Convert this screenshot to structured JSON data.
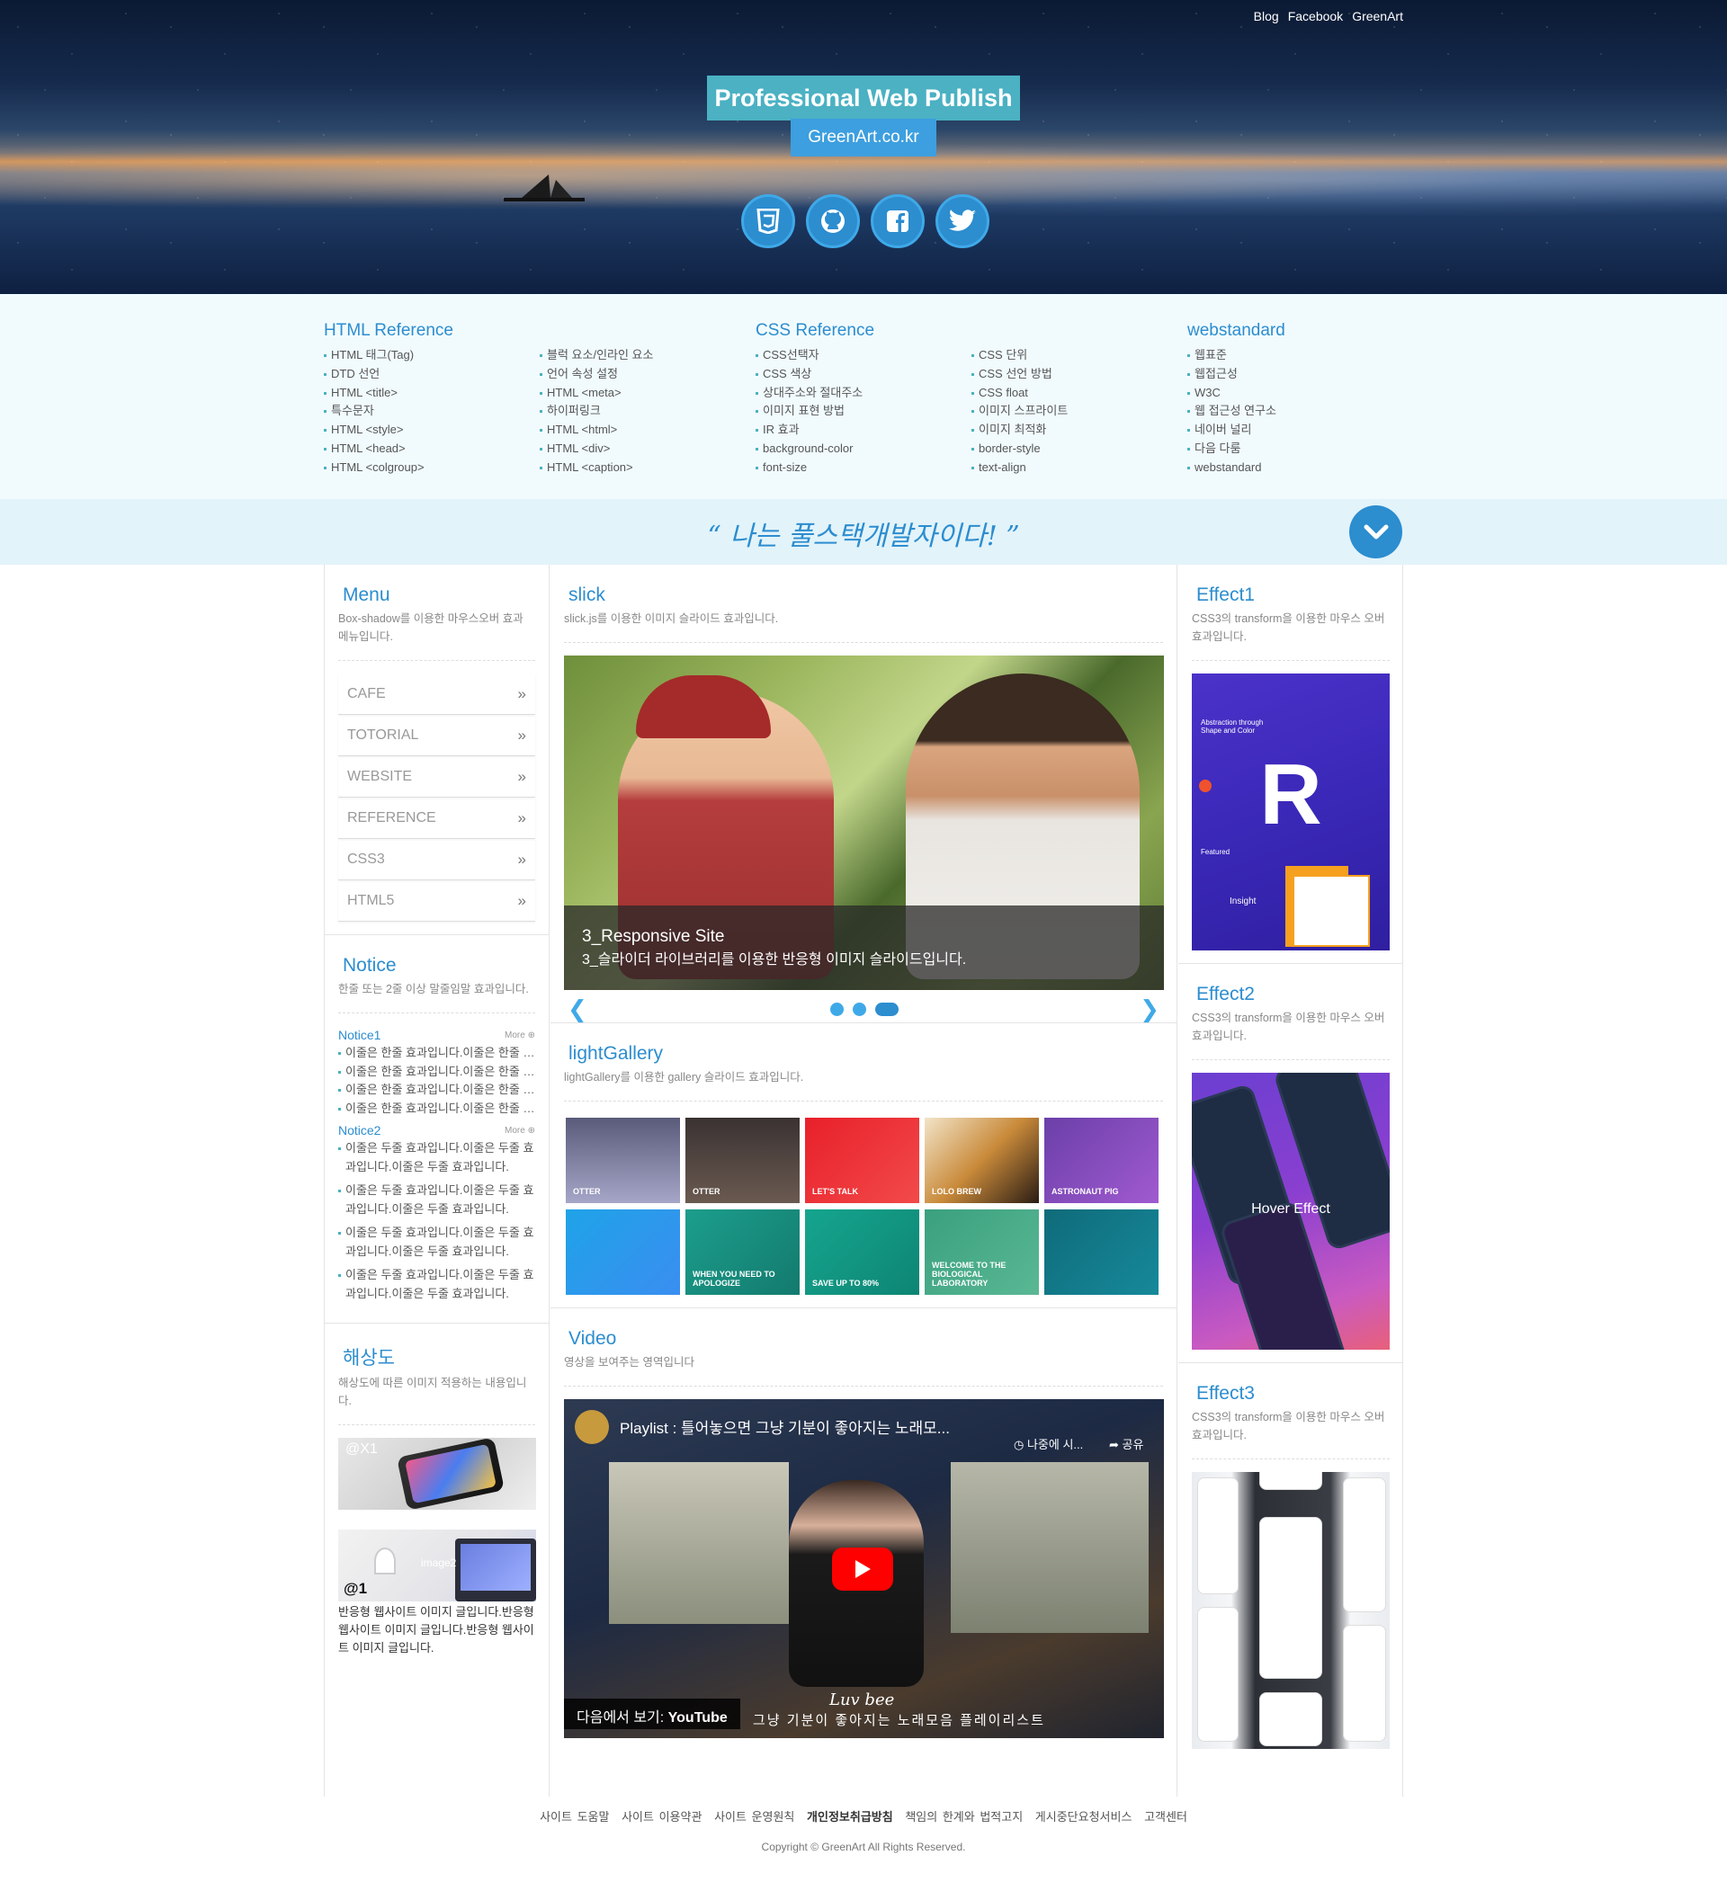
{
  "header": {
    "top_links": [
      "Blog",
      "Facebook",
      "GreenArt"
    ],
    "title": "Professional Web Publish",
    "subtitle": "GreenArt.co.kr",
    "social_icons": [
      "css3-icon",
      "github-icon",
      "facebook-icon",
      "twitter-icon"
    ]
  },
  "reference": {
    "html_title": "HTML Reference",
    "html_col1": [
      "HTML 태그(Tag)",
      "DTD 선언",
      "HTML <title>",
      "특수문자",
      "HTML <style>",
      "HTML <head>",
      "HTML <colgroup>"
    ],
    "html_col2": [
      "블럭 요소/인라인 요소",
      "언어 속성 설정",
      "HTML <meta>",
      "하이퍼링크",
      "HTML <html>",
      "HTML <div>",
      "HTML <caption>"
    ],
    "css_title": "CSS Reference",
    "css_col1": [
      "CSS선택자",
      "CSS 색상",
      "상대주소와 절대주소",
      "이미지 표현 방법",
      "IR 효과",
      "background-color",
      "font-size"
    ],
    "css_col2": [
      "CSS 단위",
      "CSS 선언 방법",
      "CSS float",
      "이미지 스프라이트",
      "이미지 최적화",
      "border-style",
      "text-align"
    ],
    "web_title": "webstandard",
    "web_col": [
      "웹표준",
      "웹접근성",
      "W3C",
      "웹 접근성 연구소",
      "네이버 널리",
      "다음 다룸",
      "webstandard"
    ]
  },
  "quote": "“ 나는 풀스택개발자이다! ”",
  "left": {
    "menu_title": "Menu",
    "menu_desc": "Box-shadow를 이용한 마우스오버 효과 메뉴입니다.",
    "menu_items": [
      "CAFE",
      "TOTORIAL",
      "WEBSITE",
      "REFERENCE",
      "CSS3",
      "HTML5"
    ],
    "notice_title": "Notice",
    "notice_desc": "한줄 또는 2줄 이상 말줄임말 효과입니다.",
    "notice1_label": "Notice1",
    "notice2_label": "Notice2",
    "more_label": "More",
    "notice1": [
      "이줄은 한줄 효과입니다.이줄은 한줄 효과입니다.",
      "이줄은 한줄 효과입니다.이줄은 한줄 효과입니다.",
      "이줄은 한줄 효과입니다.이줄은 한줄 효과입니다.",
      "이줄은 한줄 효과입니다.이줄은 한줄 효과입니다."
    ],
    "notice2": [
      "이줄은 두줄 효과입니다.이줄은 두줄 효과입니다.이줄은 두줄 효과입니다.",
      "이줄은 두줄 효과입니다.이줄은 두줄 효과입니다.이줄은 두줄 효과입니다.",
      "이줄은 두줄 효과입니다.이줄은 두줄 효과입니다.이줄은 두줄 효과입니다.",
      "이줄은 두줄 효과입니다.이줄은 두줄 효과입니다.이줄은 두줄 효과입니다."
    ],
    "res_title": "해상도",
    "res_desc": "해상도에 따른 이미지 적용하는 내용입니다.",
    "res_img1_label": "@X1",
    "res_img2_label": "@1",
    "res_img2_sub": "image2",
    "res_text": "반응형 웹사이트 이미지 글입니다.반응형 웹사이트 이미지 글입니다.반응형 웹사이트 이미지 글입니다."
  },
  "center": {
    "slick_title": "slick",
    "slick_desc": "slick.js를 이용한 이미지 슬라이드 효과입니다.",
    "slide_title": "3_Responsive Site",
    "slide_text": "3_슬라이더 라이브러리를 이용한 반응형 이미지 슬라이드입니다.",
    "gallery_title": "lightGallery",
    "gallery_desc": "lightGallery를 이용한 gallery 슬라이드 효과입니다.",
    "gallery_labels": [
      "OTTER",
      "OTTER",
      "LET'S TALK",
      "LOLO BREW",
      "ASTRONAUT PIG",
      "",
      "WHEN YOU NEED TO APOLOGIZE",
      "SAVE UP TO 80%",
      "WELCOME TO THE BIOLOGICAL LABORATORY",
      ""
    ],
    "video_title": "Video",
    "video_desc": "영상을 보여주는 영역입니다",
    "video_heading": "Playlist : 틀어놓으면 그냥 기분이 좋아지는 노래모...",
    "video_later": "나중에 시...",
    "video_share": "공유",
    "video_watch": "다음에서 보기:",
    "video_youtube": "YouTube",
    "video_bottom": "그냥 기분이 좋아지는 노래모음 플레이리스트",
    "video_script": "Luv bee"
  },
  "right": {
    "e1_title": "Effect1",
    "e1_desc": "CSS3의 transform을 이용한 마우스 오버 효과입니다.",
    "e1_img_text1": "Abstraction through Shape and Color",
    "e1_img_text2": "Featured",
    "e1_img_text3": "Insight",
    "e2_title": "Effect2",
    "e2_desc": "CSS3의 transform을 이용한 마우스 오버 효과입니다.",
    "e2_caption": "Hover Effect",
    "e3_title": "Effect3",
    "e3_desc": "CSS3의 transform을 이용한 마우스 오버 효과입니다."
  },
  "footer": {
    "links": [
      "사이트 도움말",
      "사이트 이용약관",
      "사이트 운영원칙",
      "개인정보취급방침",
      "책임의 한계와 법적고지",
      "게시중단요청서비스",
      "고객센터"
    ],
    "copyright": "Copyright © GreenArt All Rights Reserved."
  },
  "colors": {
    "accent": "#2c8dcf",
    "title_bg": "#4bb1c3",
    "sub_bg": "#3d9fdf"
  }
}
